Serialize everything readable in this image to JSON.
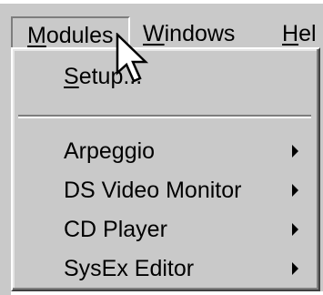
{
  "menubar": {
    "modules": {
      "u": "M",
      "rest": "odules"
    },
    "windows": {
      "u": "W",
      "rest": "indows"
    },
    "help": {
      "pre": "",
      "u": "H",
      "rest": "el"
    }
  },
  "dropdown": {
    "setup": {
      "u": "S",
      "rest": "etup..."
    },
    "items": [
      {
        "label": "Arpeggio",
        "submenu": true
      },
      {
        "label": "DS Video Monitor",
        "submenu": true
      },
      {
        "label": "CD Player",
        "submenu": true
      },
      {
        "label": "SysEx Editor",
        "submenu": true
      }
    ]
  },
  "cursor_icon": "arrow-pointer-icon"
}
